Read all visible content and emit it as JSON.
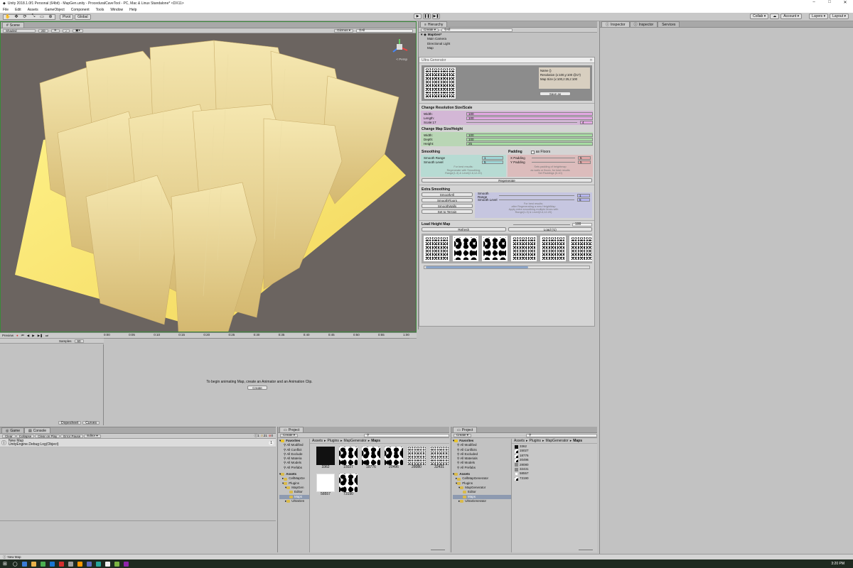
{
  "window": {
    "title": "Unity 2018.1.0f1 Personal (64bit) - MapGen.unity - ProceduralCaveTool - PC, Mac & Linux Standalone* <DX11>"
  },
  "menu": [
    "File",
    "Edit",
    "Assets",
    "GameObject",
    "Component",
    "Tools",
    "Window",
    "Help"
  ],
  "toolbar": {
    "pivot": "Pivot",
    "global": "Global",
    "collab": "Collab ▾",
    "account": "Account ▾",
    "layers": "Layers ▾",
    "layout": "Layout ▾"
  },
  "scene": {
    "tab": "Scene",
    "shading": "Shaded",
    "mode2d": "2D",
    "gizmos": "Gizmos ▾",
    "persp": "< Persp"
  },
  "animation": {
    "preview": "Preview",
    "samples_label": "Samples",
    "samples_value": "60",
    "ticks": [
      "0:00",
      "0:05",
      "0:10",
      "0:15",
      "0:20",
      "0:25",
      "0:30",
      "0:35",
      "0:40",
      "0:45",
      "0:50",
      "0:55",
      "1:00"
    ],
    "message": "To begin animating Map, create an Animator and an Animation Clip.",
    "create": "Create",
    "tabs": [
      "Dopesheet",
      "Curves"
    ]
  },
  "hierarchy": {
    "tab": "Hierarchy",
    "create": "Create ▾",
    "root": "MapGen*",
    "items": [
      "Main Camera",
      "Directional Light",
      "Map"
    ]
  },
  "ultra": {
    "title": "Ultra Generator",
    "info": {
      "name": "Name ()",
      "resolution": "Resolution (x:100,y:100 @17)",
      "mapsize": "Map Size (x:100,z:25,z:100",
      "save": "Save as"
    },
    "res_title": "Change Resolution Size/Scale",
    "res": [
      {
        "label": "Width:",
        "value": "100"
      },
      {
        "label": "Length:",
        "value": "100"
      },
      {
        "label": "Scale:17",
        "value": "4"
      }
    ],
    "size_title": "Change Map Size/Height",
    "size": [
      {
        "label": "Width:",
        "value": "100"
      },
      {
        "label": "Depth:",
        "value": "100"
      },
      {
        "label": "Height:",
        "value": "25"
      }
    ],
    "smoothing_title": "Smoothing",
    "smoothing": [
      {
        "label": "Smooth Range",
        "value": "1"
      },
      {
        "label": "Smooth Level",
        "value": "5"
      }
    ],
    "smoothing_note": [
      "For best results:",
      "Regenerate with Smoothing",
      "Range(1-3) & Level(2-6,12-20)"
    ],
    "padding_title": "Padding",
    "padding_check": "as Floors",
    "padding": [
      {
        "label": "X Padding",
        "value": "5"
      },
      {
        "label": "Y Padding",
        "value": "5"
      }
    ],
    "padding_note": [
      "Sets padding of heightmap",
      "as walls or floors, for best results",
      "Set Paddings (0-10)"
    ],
    "regenerate": "Regenerate",
    "extra_title": "Extra Smoothing",
    "extra_buttons": [
      "SmoothAll",
      "SmoothFloors",
      "SmoothWalls",
      "Set to Terrain"
    ],
    "extra": [
      {
        "label": "Smooth Range",
        "value": "1"
      },
      {
        "label": "Smooth Level",
        "value": "5"
      }
    ],
    "extra_note": [
      "For best results:",
      "after Regenerating a new HeightMap",
      "Apply extra smoothing multiple times with",
      "Range(1-3) & Level(2-6,12-20)"
    ],
    "load_title": "Load Height Map",
    "load_value": "100",
    "refresh": "Refresh",
    "load": "Load (!1)",
    "thumbs": [
      "noise",
      "blob",
      "blob",
      "noise",
      "noise",
      "noise"
    ]
  },
  "inspector": {
    "tabs": [
      "Inspector",
      "Inspector",
      "Services"
    ]
  },
  "console": {
    "tabs": [
      "Game",
      "Console"
    ],
    "buttons": [
      "Clear",
      "Collapse",
      "Clear on Play",
      "Error Pause",
      "Editor ▾"
    ],
    "counts": [
      "1",
      "21",
      "0"
    ],
    "log_line1": "New Map",
    "log_line2": "UnityEngine.Debug:Log(Object)",
    "log_count": "1"
  },
  "project1": {
    "tab": "Project",
    "create": "Create ▾",
    "breadcrumb": [
      "Assets",
      "Plugins",
      "MapGenerator",
      "Maps"
    ],
    "favorites": "Favorites",
    "fav_items": [
      "All Modified",
      "All Conflict",
      "All Exclude",
      "All Materia",
      "All Models",
      "All Prefabs"
    ],
    "assets": "Assets",
    "tree": [
      "CellMapGe",
      "Plugins",
      "MapGen",
      "Editor",
      "Maps",
      "UltraGen"
    ],
    "files": [
      {
        "name": "3362",
        "kind": "black"
      },
      {
        "name": "15027",
        "kind": "blob"
      },
      {
        "name": "18776",
        "kind": "blob"
      },
      {
        "name": "20496",
        "kind": "blob"
      },
      {
        "name": "28080",
        "kind": "noise"
      },
      {
        "name": "32431",
        "kind": "noise"
      },
      {
        "name": "58557",
        "kind": "white"
      },
      {
        "name": "73190",
        "kind": "blob"
      }
    ]
  },
  "project2": {
    "tab": "Project",
    "create": "Create ▾",
    "breadcrumb": [
      "Assets",
      "Plugins",
      "MapGenerator",
      "Maps"
    ],
    "favorites": "Favorites",
    "fav_items": [
      "All Modified",
      "All Conflicts",
      "All Excluded",
      "All Materials",
      "All Models",
      "All Prefabs"
    ],
    "assets": "Assets",
    "tree": [
      "CellMapGenerator",
      "Plugins",
      "MapGenerator",
      "Editor",
      "Maps",
      "UltraGenerator"
    ],
    "files": [
      "3362",
      "15027",
      "18776",
      "20496",
      "28080",
      "32431",
      "58557",
      "73190"
    ]
  },
  "status": {
    "text": "New Map"
  },
  "clock": {
    "time": "3:20 PM"
  }
}
